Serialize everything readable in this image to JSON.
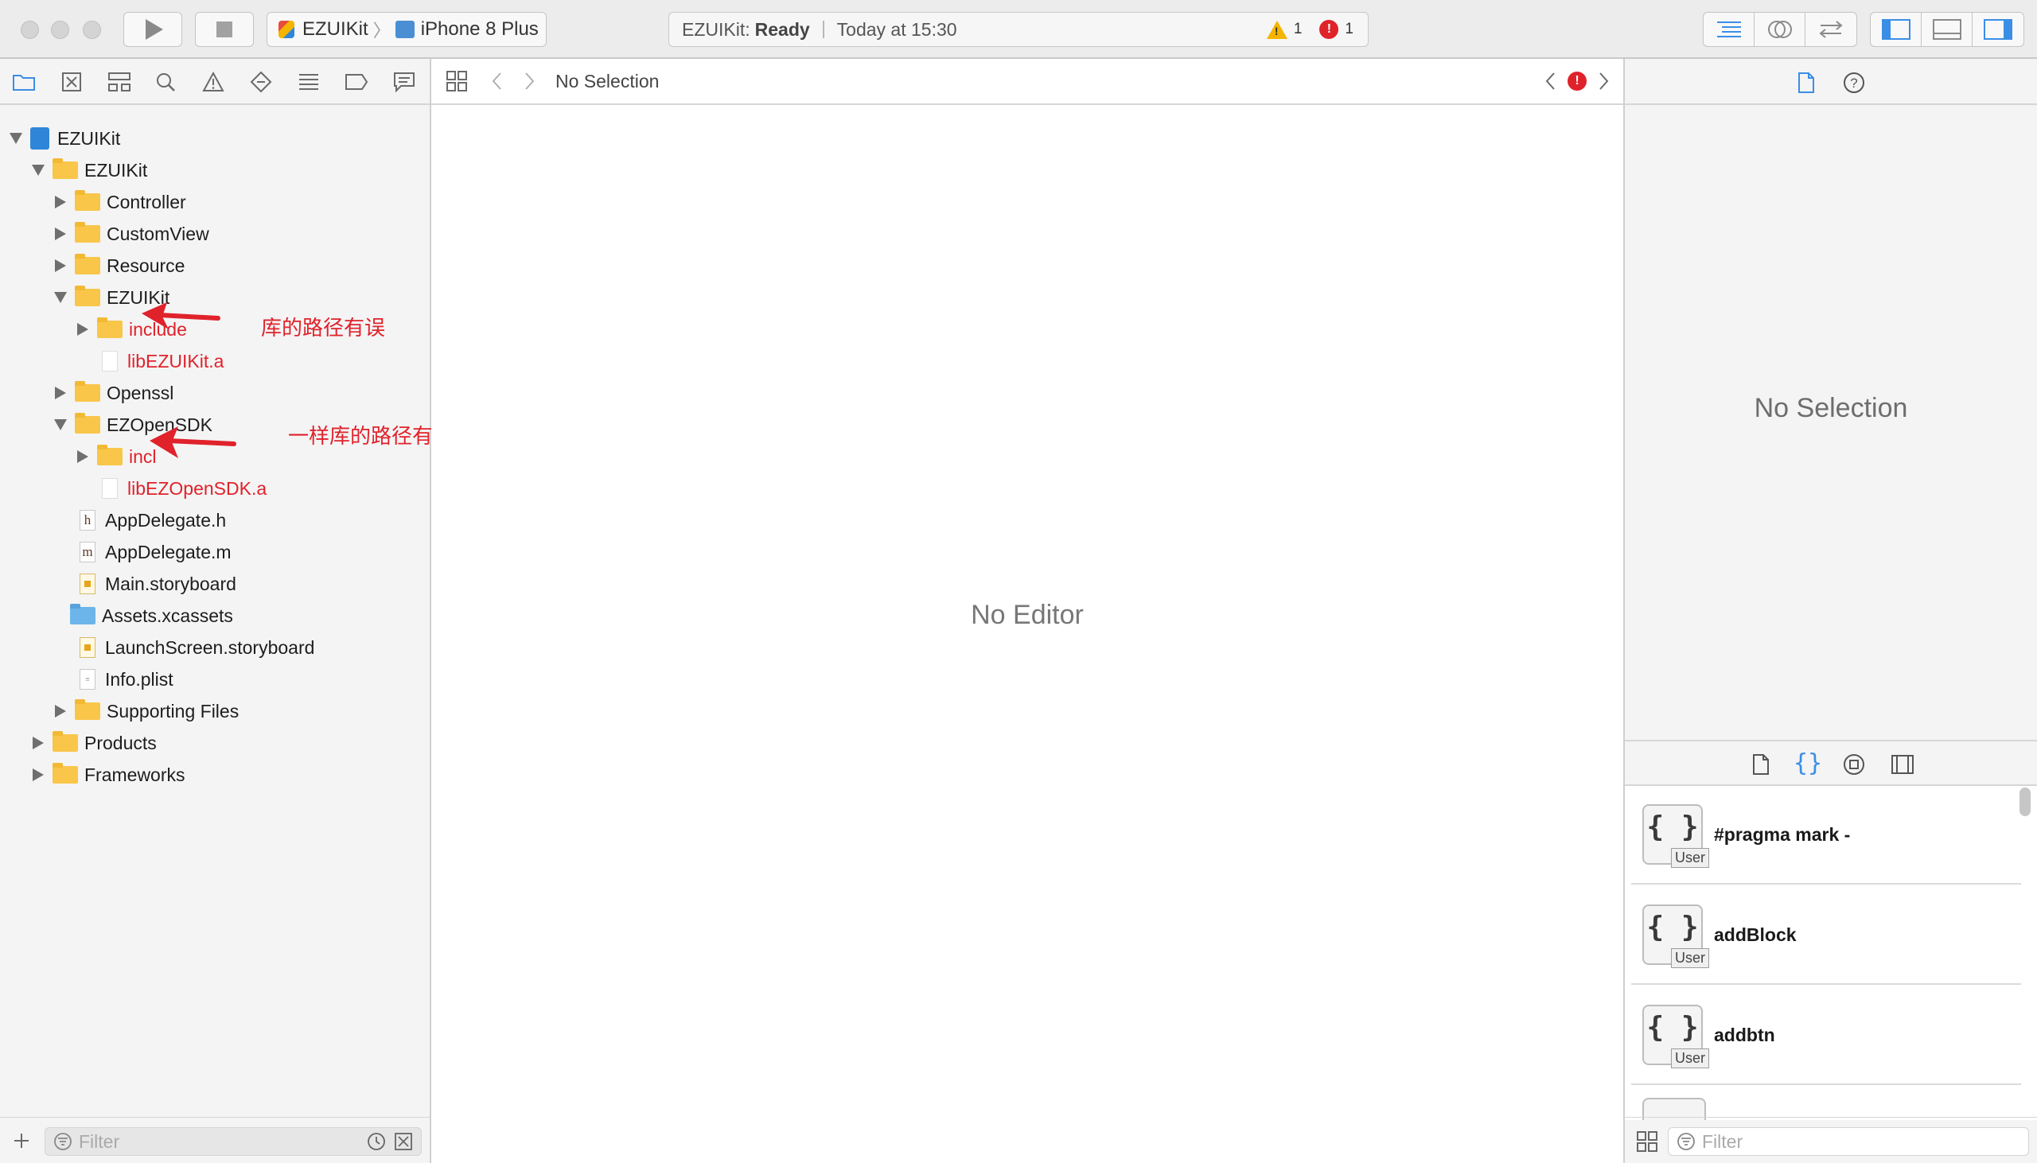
{
  "toolbar": {
    "scheme_name": "EZUIKit",
    "device_name": "iPhone 8 Plus",
    "status_project": "EZUIKit:",
    "status_state": "Ready",
    "status_time": "Today at 15:30",
    "warning_count": "1",
    "error_count": "1"
  },
  "navigator": {
    "items": [
      {
        "label": "EZUIKit"
      },
      {
        "label": "EZUIKit"
      },
      {
        "label": "Controller"
      },
      {
        "label": "CustomView"
      },
      {
        "label": "Resource"
      },
      {
        "label": "EZUIKit"
      },
      {
        "label": "include"
      },
      {
        "label": "libEZUIKit.a"
      },
      {
        "label": "Openssl"
      },
      {
        "label": "EZOpenSDK"
      },
      {
        "label": "incl"
      },
      {
        "label": "libEZOpenSDK.a"
      },
      {
        "label": "AppDelegate.h"
      },
      {
        "label": "AppDelegate.m"
      },
      {
        "label": "Main.storyboard"
      },
      {
        "label": "Assets.xcassets"
      },
      {
        "label": "LaunchScreen.storyboard"
      },
      {
        "label": "Info.plist"
      },
      {
        "label": "Supporting Files"
      },
      {
        "label": "Products"
      },
      {
        "label": "Frameworks"
      }
    ],
    "filter_placeholder": "Filter",
    "annotations": [
      "库的路径有误",
      "一样库的路径有误"
    ]
  },
  "editor": {
    "jump_bar_text": "No Selection",
    "empty_text": "No Editor"
  },
  "inspector": {
    "empty_text": "No Selection",
    "snippets": [
      {
        "title": "#pragma mark -",
        "badge": "User",
        "glyph": "{ }"
      },
      {
        "title": "addBlock",
        "badge": "User",
        "glyph": "{ }"
      },
      {
        "title": "addbtn",
        "badge": "User",
        "glyph": "{ }"
      }
    ],
    "filter_placeholder": "Filter"
  },
  "colors": {
    "error_red": "#e0222b",
    "warning_yellow": "#f4b400",
    "folder_yellow": "#f9c64a",
    "accent_blue": "#2f86d9"
  }
}
